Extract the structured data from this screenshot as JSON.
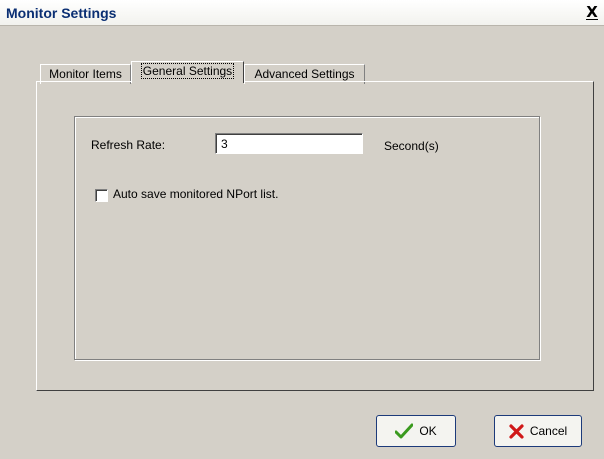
{
  "window": {
    "title": "Monitor Settings",
    "close_glyph": "X"
  },
  "tabs": [
    {
      "label": "Monitor Items",
      "active": false
    },
    {
      "label": "General Settings",
      "active": true
    },
    {
      "label": "Advanced Settings",
      "active": false
    }
  ],
  "general": {
    "refresh_rate_label": "Refresh Rate:",
    "refresh_rate_value": "3",
    "refresh_rate_unit": "Second(s)",
    "auto_save_label": "Auto save monitored NPort list.",
    "auto_save_checked": false
  },
  "buttons": {
    "ok_label": "OK",
    "cancel_label": "Cancel",
    "ok_icon": "checkmark-icon",
    "cancel_icon": "red-x-icon"
  },
  "colors": {
    "ok_check": "#3a9a1e",
    "cancel_x": "#d01818",
    "title_text": "#0b2f73"
  }
}
